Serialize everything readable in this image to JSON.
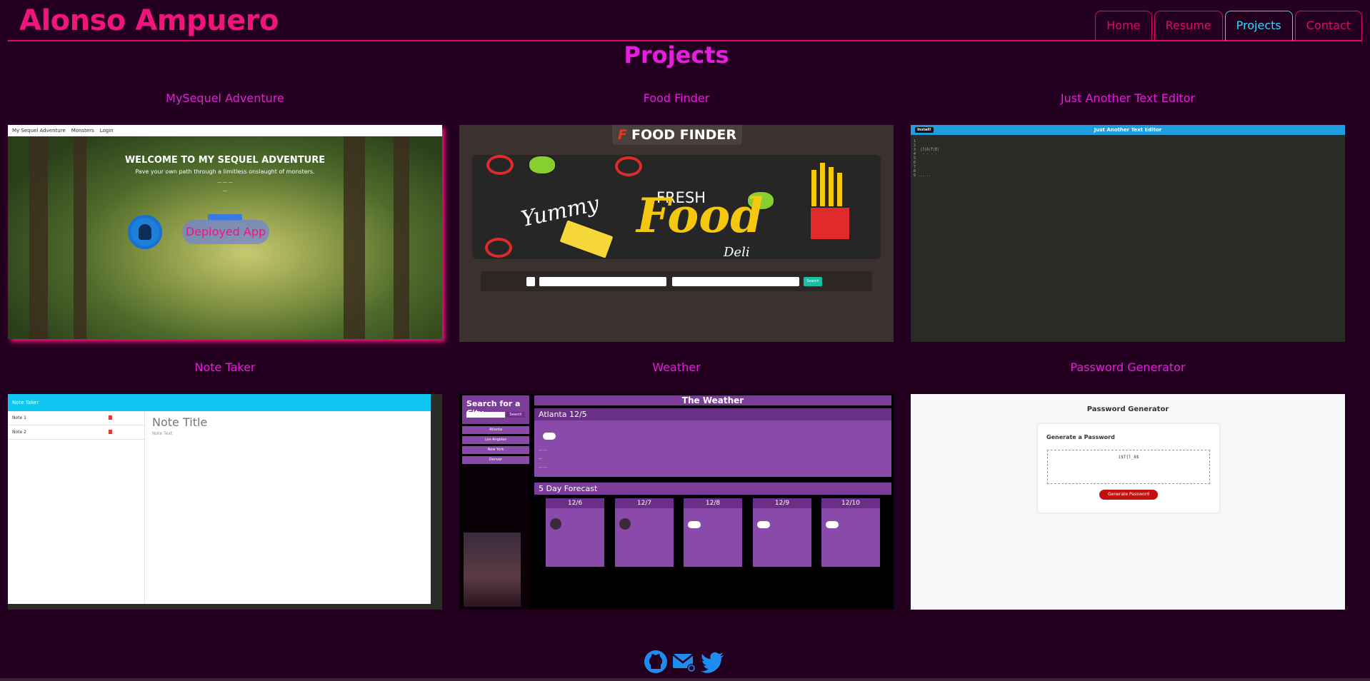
{
  "header": {
    "site_title": "Alonso Ampuero",
    "nav": [
      "Home",
      "Resume",
      "Projects",
      "Contact"
    ],
    "active_tab": "Projects"
  },
  "page_title": "Projects",
  "projects": [
    {
      "title": "MySequel Adventure",
      "preview": {
        "nav_brand": "My Sequel Adventure",
        "nav_links": [
          "Monsters",
          "Login"
        ],
        "heading": "WELCOME TO MY SEQUEL ADVENTURE",
        "subheading": "Pave your own path through a limitless onslaught of monsters.",
        "overlay_label": "Deployed App"
      }
    },
    {
      "title": "Food Finder",
      "preview": {
        "brand": "FOOD FINDER",
        "banner_words": [
          "Yummy",
          "FRESH",
          "Food",
          "Deli"
        ],
        "search_button": "Search"
      }
    },
    {
      "title": "Just Another Text Editor",
      "preview": {
        "app_bar_title": "Just Another Text Editor",
        "install_button": "Install!"
      }
    },
    {
      "title": "Note Taker",
      "preview": {
        "app_bar_title": "Note Taker",
        "notes": [
          "Note 1",
          "Note 2"
        ],
        "note_title_placeholder": "Note Title",
        "note_text_placeholder": "Note Text"
      }
    },
    {
      "title": "Weather",
      "preview": {
        "sidebar_heading": "Search for a City",
        "search_button": "Search",
        "cities": [
          "Atlanta",
          "Los Angeles",
          "New York",
          "Denver"
        ],
        "app_heading": "The Weather",
        "current_heading": "Atlanta 12/5",
        "forecast_heading": "5 Day Forecast",
        "forecast_days": [
          "12/6",
          "12/7",
          "12/8",
          "12/9",
          "12/10"
        ]
      }
    },
    {
      "title": "Password Generator",
      "preview": {
        "heading": "Password Generator",
        "card_heading": "Generate a Password",
        "password_value": "i$T{l_8$",
        "button": "Generate Password"
      }
    }
  ],
  "footer": {
    "icons": [
      "github-icon",
      "email-icon",
      "twitter-icon"
    ]
  },
  "colors": {
    "background": "#23001f",
    "brand_pink": "#f0147c",
    "section_magenta": "#e71ce0",
    "active_cyan": "#3ad6f5",
    "footer_blue": "#1d8df0"
  }
}
